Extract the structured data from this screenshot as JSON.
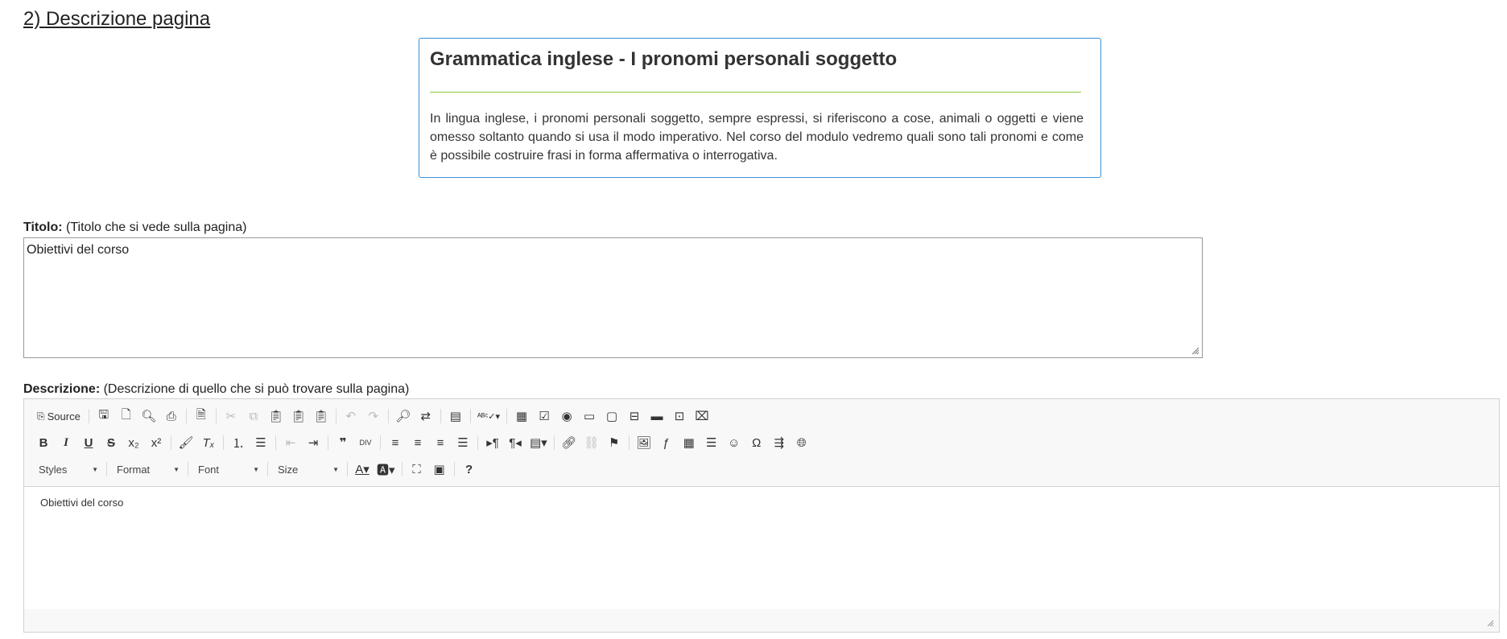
{
  "section": {
    "heading": "2) Descrizione pagina"
  },
  "preview": {
    "title": "Grammatica inglese - I pronomi personali soggetto",
    "body": "In lingua inglese, i pronomi personali soggetto, sempre espressi, si riferiscono a cose, animali o oggetti e viene omesso soltanto quando si usa il modo imperativo. Nel corso del modulo vedremo quali sono tali pronomi e come è possibile costruire frasi in forma affermativa o interrogativa.",
    "accent_color": "#8cc63f",
    "border_color": "#3a8fd6"
  },
  "title_field": {
    "label": "Titolo:",
    "hint": "(Titolo che si vede sulla pagina)",
    "value": "Obiettivi del corso"
  },
  "description_field": {
    "label": "Descrizione:",
    "hint": "(Descrizione di quello che si può trovare sulla pagina)",
    "content": "Obiettivi del corso"
  },
  "toolbar": {
    "source_label": "Source",
    "styles_label": "Styles",
    "format_label": "Format",
    "font_label": "Font",
    "size_label": "Size",
    "row1_icons": [
      "source-icon",
      "save-icon",
      "new-page-icon",
      "preview-icon",
      "print-icon",
      "templates-icon",
      "cut-icon",
      "copy-icon",
      "paste-icon",
      "paste-text-icon",
      "paste-word-icon",
      "undo-icon",
      "redo-icon",
      "find-icon",
      "replace-icon",
      "select-all-icon",
      "spellcheck-icon",
      "form-icon",
      "checkbox-icon",
      "radio-icon",
      "textfield-icon",
      "textarea-icon",
      "select-icon",
      "button-icon",
      "image-button-icon",
      "hidden-field-icon"
    ],
    "row2_icons": [
      "bold-icon",
      "italic-icon",
      "underline-icon",
      "strike-icon",
      "subscript-icon",
      "superscript-icon",
      "copy-format-icon",
      "remove-format-icon",
      "numbered-list-icon",
      "bulleted-list-icon",
      "outdent-icon",
      "indent-icon",
      "blockquote-icon",
      "div-icon",
      "align-left-icon",
      "align-center-icon",
      "align-right-icon",
      "justify-icon",
      "ltr-icon",
      "rtl-icon",
      "language-icon",
      "link-icon",
      "unlink-icon",
      "anchor-icon",
      "image-icon",
      "flash-icon",
      "table-icon",
      "horizontal-rule-icon",
      "smiley-icon",
      "special-char-icon",
      "page-break-icon",
      "iframe-icon"
    ],
    "row3_icons": [
      "text-color-icon",
      "bg-color-icon",
      "maximize-icon",
      "show-blocks-icon",
      "about-icon"
    ]
  }
}
